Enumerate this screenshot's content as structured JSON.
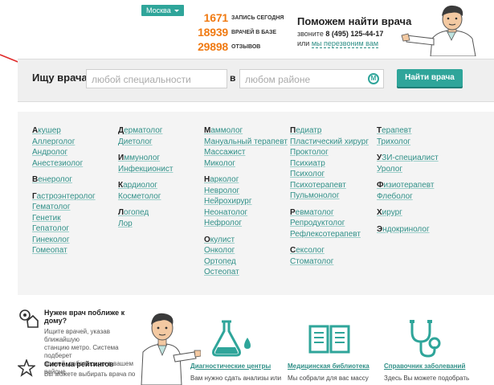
{
  "header": {
    "city": "Москва",
    "stats": [
      {
        "num": "1671",
        "label": "запись сегодня"
      },
      {
        "num": "18939",
        "label": "врачей в базе"
      },
      {
        "num": "29898",
        "label": "отзывов"
      }
    ],
    "help_title": "Поможем найти врача",
    "help_call": "звоните",
    "help_phone": "8 (495) 125-44-17",
    "help_or": "или",
    "help_callback": "мы перезвоним вам"
  },
  "search": {
    "label": "Ищу врача",
    "specialty_placeholder": "любой специальности",
    "in_word": "в",
    "district_placeholder": "любом районе",
    "metro_icon": "М",
    "button": "Найти врача"
  },
  "columns": [
    [
      [
        "Акушер",
        "Аллерголог",
        "Андролог",
        "Анестезиолог"
      ],
      [
        "Венеролог"
      ],
      [
        "Гастроэнтеролог",
        "Гематолог",
        "Генетик",
        "Гепатолог",
        "Гинеколог",
        "Гомеопат"
      ]
    ],
    [
      [
        "Дерматолог",
        "Диетолог"
      ],
      [
        "Иммунолог",
        "Инфекционист"
      ],
      [
        "Кардиолог",
        "Косметолог"
      ],
      [
        "Логопед",
        "Лор"
      ]
    ],
    [
      [
        "Маммолог",
        "Мануальный терапевт",
        "Массажист",
        "Миколог"
      ],
      [
        "Нарколог",
        "Невролог",
        "Нейрохирург",
        "Неонатолог",
        "Нефролог"
      ],
      [
        "Окулист",
        "Онколог",
        "Ортопед",
        "Остеопат"
      ]
    ],
    [
      [
        "Педиатр",
        "Пластический хирург",
        "Проктолог",
        "Психиатр",
        "Психолог",
        "Психотерапевт",
        "Пульмонолог"
      ],
      [
        "Ревматолог",
        "Репродуктолог",
        "Рефлексотерапевт"
      ],
      [
        "Сексолог",
        "Стоматолог"
      ]
    ],
    [
      [
        "Терапевт",
        "Трихолог"
      ],
      [
        "УЗИ-специалист",
        "Уролог"
      ],
      [
        "Физиотерапевт",
        "Флеболог"
      ],
      [
        "Хирург"
      ],
      [
        "Эндокринолог"
      ]
    ]
  ],
  "bottom": {
    "near_title": "Нужен врач поближе к дому?",
    "near_desc": [
      "Ищите врачей, указав ближайшую",
      "станцию метро. Система подберет",
      "врачей, работающих в вашем",
      "районе."
    ],
    "rating_title": "Система рейтингов",
    "rating_desc": "Вы можете выбирать врача по",
    "services": [
      {
        "title": "Диагностические центры",
        "desc": "Вам нужно сдать анализы или"
      },
      {
        "title": "Медицинская библиотека",
        "desc": "Мы собрали для вас массу"
      },
      {
        "title": "Справочник заболеваний",
        "desc": "Здесь Вы можете подобрать"
      }
    ]
  },
  "colors": {
    "accent": "#2fa59a",
    "orange": "#f07a12",
    "link": "#2f8f87"
  }
}
